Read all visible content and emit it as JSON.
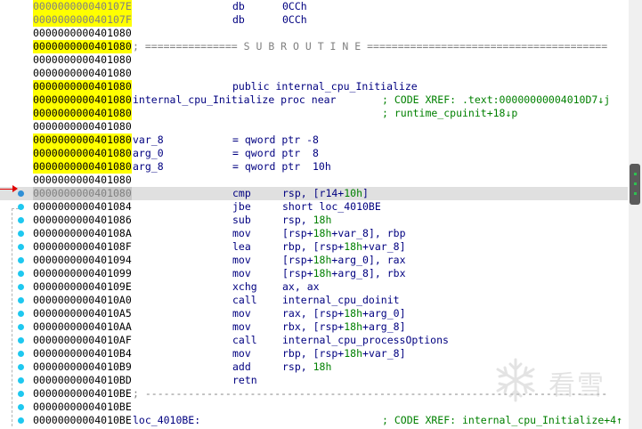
{
  "colors": {
    "address": "#000000",
    "address_highlight": "#ffff00",
    "instruction": "#000080",
    "comment": "#008000",
    "separator": "#808080",
    "gutter_dot": "#1ec8f0",
    "current_line_bg": "#e0e0e0",
    "arrow": "#e00000"
  },
  "lines": [
    {
      "addr": "000000000040107E",
      "hl": true,
      "gray": true,
      "mnem": "db",
      "ops": [
        {
          "t": "0CCh"
        }
      ]
    },
    {
      "addr": "000000000040107F",
      "hl": true,
      "gray": true,
      "mnem": "db",
      "ops": [
        {
          "t": "0CCh"
        }
      ]
    },
    {
      "addr": "0000000000401080"
    },
    {
      "addr": "0000000000401080",
      "hl": true,
      "sep": "; =============== S U B R O U T I N E ======================================="
    },
    {
      "addr": "0000000000401080"
    },
    {
      "addr": "0000000000401080"
    },
    {
      "addr": "0000000000401080",
      "hl": true,
      "mnem": "public internal_cpu_Initialize"
    },
    {
      "addr": "0000000000401080",
      "hl": true,
      "label": "internal_cpu_Initialize proc near",
      "cmt": "; CODE XREF: .text:00000000004010D7↓j"
    },
    {
      "addr": "0000000000401080",
      "hl": true,
      "cmt": "; runtime_cpuinit+18↓p"
    },
    {
      "addr": "0000000000401080"
    },
    {
      "addr": "0000000000401080",
      "hl": true,
      "label": "var_8",
      "mnem": "= qword ptr -8"
    },
    {
      "addr": "0000000000401080",
      "hl": true,
      "label": "arg_0",
      "mnem": "= qword ptr  8"
    },
    {
      "addr": "0000000000401080",
      "hl": true,
      "label": "arg_8",
      "mnem": "= qword ptr  10h"
    },
    {
      "addr": "0000000000401080"
    },
    {
      "addr": "0000000000401080",
      "current": true,
      "dot": true,
      "mnem": "cmp",
      "ops": [
        {
          "t": "rsp, [r14+"
        },
        {
          "t": "10h",
          "num": true
        },
        {
          "t": "]"
        }
      ]
    },
    {
      "addr": "0000000000401084",
      "dot": true,
      "mnem": "jbe",
      "ops": [
        {
          "t": "short loc_4010BE"
        }
      ]
    },
    {
      "addr": "0000000000401086",
      "dot": true,
      "mnem": "sub",
      "ops": [
        {
          "t": "rsp, "
        },
        {
          "t": "18h",
          "num": true
        }
      ]
    },
    {
      "addr": "000000000040108A",
      "dot": true,
      "mnem": "mov",
      "ops": [
        {
          "t": "[rsp+"
        },
        {
          "t": "18h",
          "num": true
        },
        {
          "t": "+var_8], rbp"
        }
      ]
    },
    {
      "addr": "000000000040108F",
      "dot": true,
      "mnem": "lea",
      "ops": [
        {
          "t": "rbp, [rsp+"
        },
        {
          "t": "18h",
          "num": true
        },
        {
          "t": "+var_8]"
        }
      ]
    },
    {
      "addr": "0000000000401094",
      "dot": true,
      "mnem": "mov",
      "ops": [
        {
          "t": "[rsp+"
        },
        {
          "t": "18h",
          "num": true
        },
        {
          "t": "+arg_0], rax"
        }
      ]
    },
    {
      "addr": "0000000000401099",
      "dot": true,
      "mnem": "mov",
      "ops": [
        {
          "t": "[rsp+"
        },
        {
          "t": "18h",
          "num": true
        },
        {
          "t": "+arg_8], rbx"
        }
      ]
    },
    {
      "addr": "000000000040109E",
      "dot": true,
      "mnem": "xchg",
      "ops": [
        {
          "t": "ax, ax"
        }
      ]
    },
    {
      "addr": "00000000004010A0",
      "dot": true,
      "mnem": "call",
      "ops": [
        {
          "t": "internal_cpu_doinit"
        }
      ]
    },
    {
      "addr": "00000000004010A5",
      "dot": true,
      "mnem": "mov",
      "ops": [
        {
          "t": "rax, [rsp+"
        },
        {
          "t": "18h",
          "num": true
        },
        {
          "t": "+arg_0]"
        }
      ]
    },
    {
      "addr": "00000000004010AA",
      "dot": true,
      "mnem": "mov",
      "ops": [
        {
          "t": "rbx, [rsp+"
        },
        {
          "t": "18h",
          "num": true
        },
        {
          "t": "+arg_8]"
        }
      ]
    },
    {
      "addr": "00000000004010AF",
      "dot": true,
      "mnem": "call",
      "ops": [
        {
          "t": "internal_cpu_processOptions"
        }
      ]
    },
    {
      "addr": "00000000004010B4",
      "dot": true,
      "mnem": "mov",
      "ops": [
        {
          "t": "rbp, [rsp+"
        },
        {
          "t": "18h",
          "num": true
        },
        {
          "t": "+var_8]"
        }
      ]
    },
    {
      "addr": "00000000004010B9",
      "dot": true,
      "mnem": "add",
      "ops": [
        {
          "t": "rsp, "
        },
        {
          "t": "18h",
          "num": true
        }
      ]
    },
    {
      "addr": "00000000004010BD",
      "dot": true,
      "mnem": "retn"
    },
    {
      "addr": "00000000004010BE",
      "dot": true,
      "sep": "; ---------------------------------------------------------------------------"
    },
    {
      "addr": "00000000004010BE",
      "dot": true
    },
    {
      "addr": "00000000004010BE",
      "dot": true,
      "label": "loc_4010BE:",
      "cmt": "; CODE XREF: internal_cpu_Initialize+4↑"
    }
  ],
  "watermark": {
    "text": "看雪"
  }
}
